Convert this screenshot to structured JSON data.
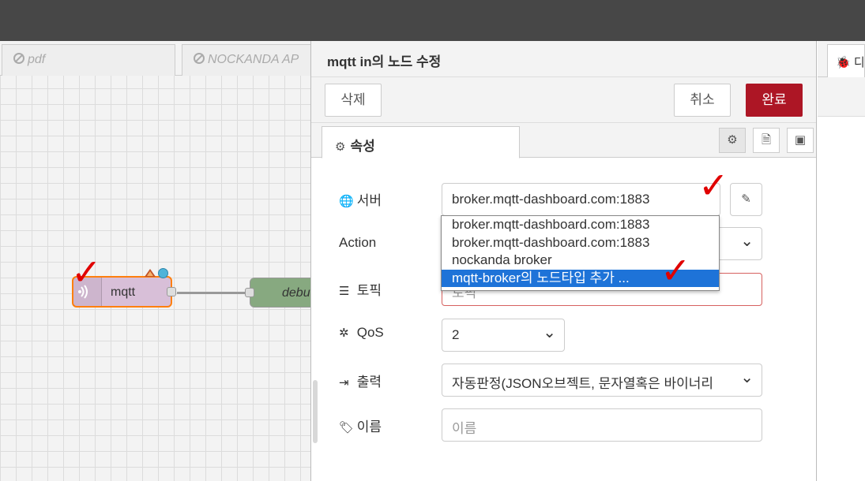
{
  "workspace": {
    "tabs": [
      {
        "label": "pdf"
      },
      {
        "label": "NOCKANDA AP"
      }
    ],
    "node_mqtt_label": "mqtt",
    "node_debug_label": "debu"
  },
  "tray": {
    "title": "mqtt in의 노드 수정",
    "delete_label": "삭제",
    "cancel_label": "취소",
    "done_label": "완료",
    "tab_properties": "속성"
  },
  "form": {
    "server_label": "서버",
    "server_value": "broker.mqtt-dashboard.com:1883",
    "action_label": "Action",
    "topic_label": "토픽",
    "topic_value": "토픽",
    "qos_label": "QoS",
    "qos_value": "2",
    "output_label": "출력",
    "output_value": "자동판정(JSON오브젝트, 문자열혹은 바이너리",
    "name_label": "이름",
    "name_placeholder": "이름"
  },
  "dropdown": {
    "options": [
      "broker.mqtt-dashboard.com:1883",
      "broker.mqtt-dashboard.com:1883",
      "nockanda broker",
      "mqtt-broker의 노드타입 추가 ..."
    ],
    "selected_index": 3
  },
  "sidebar": {
    "tab_label": "디"
  },
  "colors": {
    "topbar": "#474747",
    "primary": "#ad1625",
    "node_fill": "#d8bfd8",
    "node_border": "#ff7f0e",
    "annotation": "#e00000",
    "selection": "#1e73d8"
  },
  "annotations": {
    "mark": "✓"
  }
}
